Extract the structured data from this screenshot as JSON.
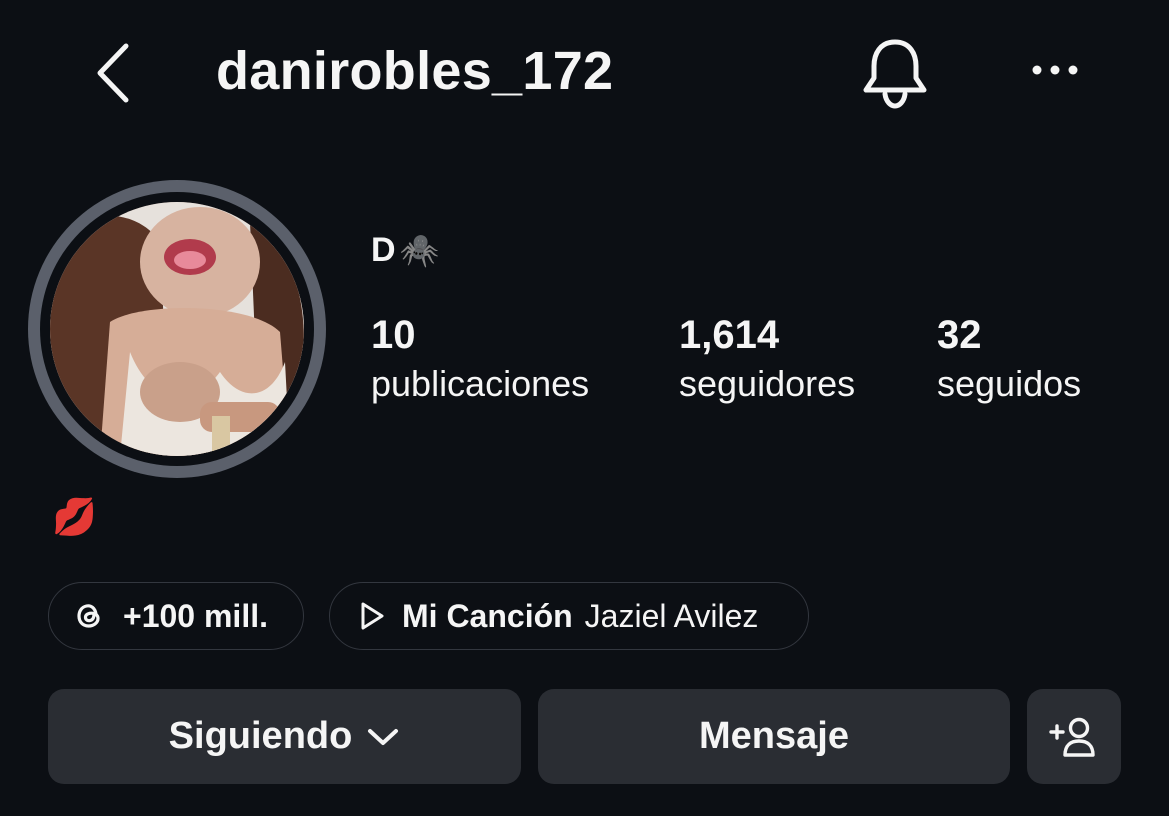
{
  "header": {
    "username": "danirobles_172",
    "icons": [
      "chevron-left-icon",
      "bell-icon",
      "more-horizontal-icon"
    ]
  },
  "profile": {
    "display_name": "D",
    "display_emoji": "🕷️",
    "bio_emoji": "💋",
    "stats": {
      "posts": {
        "value": "10",
        "label": "publicaciones"
      },
      "followers": {
        "value": "1,614",
        "label": "seguidores"
      },
      "following": {
        "value": "32",
        "label": "seguidos"
      }
    }
  },
  "pills": {
    "threads": {
      "icon": "threads-icon",
      "text": "+100 mill."
    },
    "music": {
      "icon": "play-icon",
      "title": "Mi Canción",
      "artist": "Jaziel Avilez"
    }
  },
  "actions": {
    "following_label": "Siguiendo",
    "message_label": "Mensaje",
    "add_user_icon": "add-user-icon"
  },
  "colors": {
    "background": "#0c0f14",
    "button": "#2a2d33",
    "text": "#f5f5f5",
    "ring": "#5b606b"
  }
}
